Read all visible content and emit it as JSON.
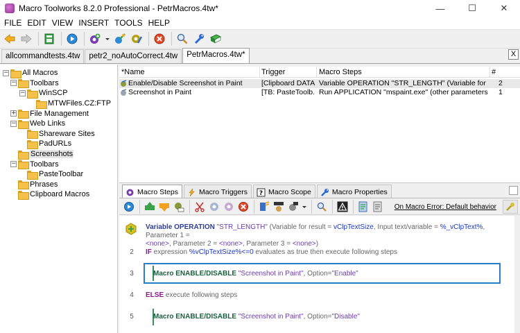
{
  "window": {
    "title": "Macro Toolworks 8.2.0 Professional - PetrMacros.4tw*",
    "minimize": "—",
    "maximize": "☐",
    "close": "✕"
  },
  "menu": [
    "FILE",
    "EDIT",
    "VIEW",
    "INSERT",
    "TOOLS",
    "HELP"
  ],
  "file_tabs": {
    "tabs": [
      "allcommandtests.4tw",
      "petr2_noAutoCorrect.4tw",
      "PetrMacros.4tw*"
    ],
    "active": 2,
    "close": "X"
  },
  "tree": {
    "items": [
      {
        "label": "All Macros",
        "sign": "−"
      },
      {
        "label": "Toolbars",
        "sign": "−"
      },
      {
        "label": "WinSCP",
        "sign": "−"
      },
      {
        "label": "MTWFiles.CZ:FTP",
        "sign": ""
      },
      {
        "label": "File Management",
        "sign": "+"
      },
      {
        "label": "Web Links",
        "sign": "−"
      },
      {
        "label": "Shareware Sites",
        "sign": ""
      },
      {
        "label": "PadURLs",
        "sign": ""
      },
      {
        "label": "Screenshots",
        "sign": ""
      },
      {
        "label": "Toolbars",
        "sign": "−"
      },
      {
        "label": "PasteToolbar",
        "sign": ""
      },
      {
        "label": "Phrases",
        "sign": ""
      },
      {
        "label": "Clipboard Macros",
        "sign": ""
      }
    ]
  },
  "macro_list": {
    "columns": [
      "*Name",
      "Trigger",
      "Macro Steps",
      "#"
    ],
    "rows": [
      {
        "name": "Enable/Disable Screenshot in Paint",
        "trigger": "[Clipboard DATA...",
        "steps": "Variable OPERATION \"STR_LENGTH\" (Variable for result ...",
        "count": "2"
      },
      {
        "name": "Screenshot in Paint",
        "trigger": "[TB: PasteToolb...",
        "steps": "Run APPLICATION \"mspaint.exe\" (other parameters: Param...",
        "count": "1"
      }
    ]
  },
  "lower_tabs": [
    "Macro Steps",
    "Macro Triggers",
    "Macro Scope",
    "Macro Properties"
  ],
  "on_error": "On Macro Error: Default behavior",
  "steps": {
    "s1": {
      "num": "1",
      "cmd": "Variable OPERATION",
      "str": "\"STR_LENGTH\"",
      "p1": "(Variable for result = ",
      "v1": "vClpTextSize",
      "p2": ", Input text/variable = ",
      "v2": "%_vClpText%",
      "p3": ", Parameter 1 =",
      "line2a": "<none>",
      "line2b": ", Parameter 2 = ",
      "line2c": "<none>",
      "line2d": ", Parameter 3 = ",
      "line2e": "<none>",
      "line2f": ")"
    },
    "s2": {
      "num": "2",
      "kw": "IF",
      "t1": " expression ",
      "expr": "%vClpTextSize%<=0",
      "t2": " evaluates as true then execute following steps"
    },
    "s3": {
      "num": "3",
      "cmd": "Macro ENABLE/DISABLE",
      "str": "\"Screenshot in Paint\"",
      "t1": ", Option=",
      "opt": "\"Enable\""
    },
    "s4": {
      "num": "4",
      "kw": "ELSE",
      "t1": " execute following steps"
    },
    "s5": {
      "num": "5",
      "cmd": "Macro ENABLE/DISABLE",
      "str": "\"Screenshot in Paint\"",
      "t1": ", Option=",
      "opt": "\"Disable\""
    }
  },
  "colors": {
    "accent_blue": "#2a7cc8",
    "keyword_blue": "#2c3d96",
    "keyword_purple": "#8a1a8a",
    "keyword_green": "#1a5e3e"
  }
}
